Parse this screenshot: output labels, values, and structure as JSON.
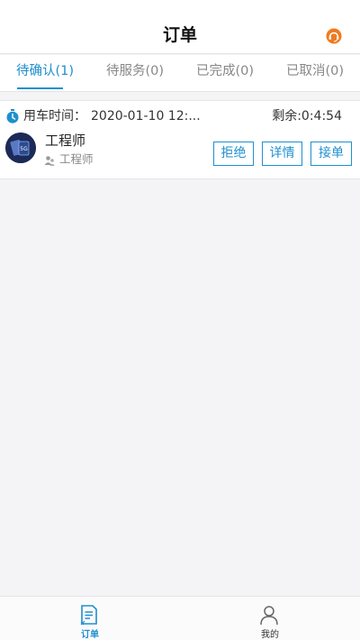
{
  "header": {
    "title": "订单",
    "support_icon": "headset-icon"
  },
  "tabs": [
    {
      "label": "待确认(1)",
      "active": true
    },
    {
      "label": "待服务(0)",
      "active": false
    },
    {
      "label": "已完成(0)",
      "active": false
    },
    {
      "label": "已取消(0)",
      "active": false
    }
  ],
  "order": {
    "time_label": "用车时间：",
    "time_value": "2020-01-10 12:...",
    "remaining": "剩余:0:4:54",
    "driver_name": "工程师",
    "driver_role": "工程师",
    "buttons": {
      "reject": "拒绝",
      "detail": "详情",
      "accept": "接单"
    }
  },
  "bottom_nav": {
    "orders_label": "订单",
    "mine_label": "我的"
  },
  "colors": {
    "accent": "#1f8fcf",
    "support_icon": "#f07a1f",
    "background": "#f4f4f6"
  }
}
